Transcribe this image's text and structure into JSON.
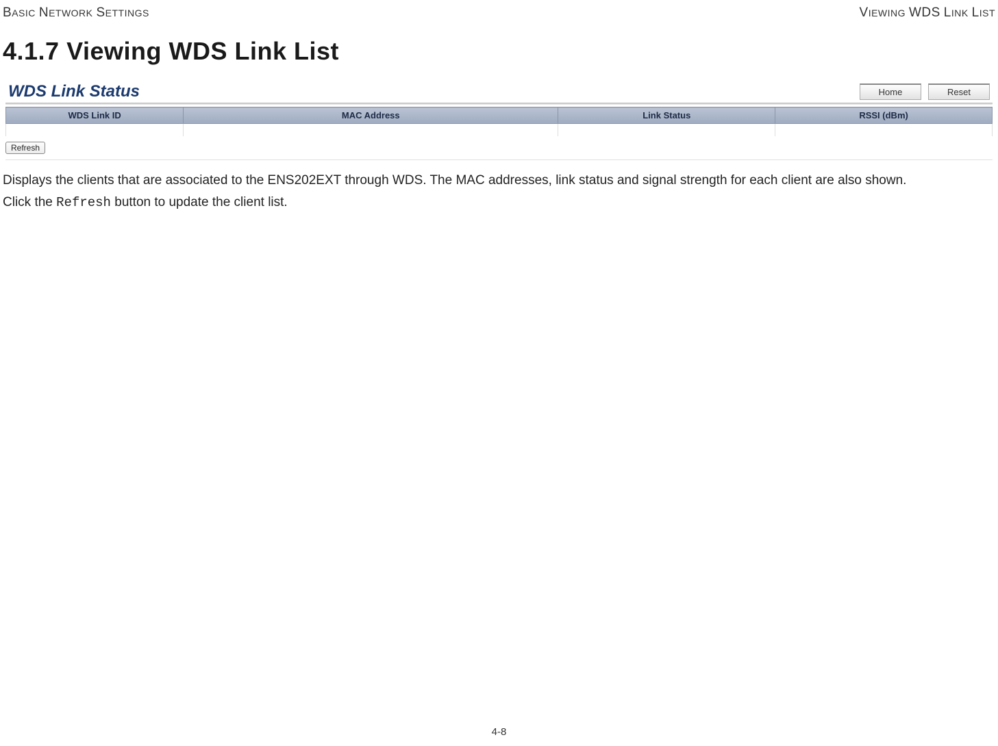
{
  "header": {
    "left": "BASIC NETWORK SETTINGS",
    "right": "VIEWING WDS LINK LIST"
  },
  "section": {
    "number": "4.1.7",
    "title": "Viewing WDS Link List"
  },
  "screenshot": {
    "panel_title": "WDS Link Status",
    "buttons": {
      "home": "Home",
      "reset": "Reset"
    },
    "columns": {
      "id": "WDS Link ID",
      "mac": "MAC Address",
      "status": "Link Status",
      "rssi": "RSSI (dBm)"
    },
    "refresh": "Refresh"
  },
  "body": {
    "p1": "Displays the clients that are associated to the ENS202EXT through WDS. The MAC addresses, link status and signal strength for each client are also shown.",
    "p2_prefix": "Click the ",
    "p2_code": "Refresh",
    "p2_suffix": " button to update the client list."
  },
  "footer": {
    "page": "4-8"
  }
}
